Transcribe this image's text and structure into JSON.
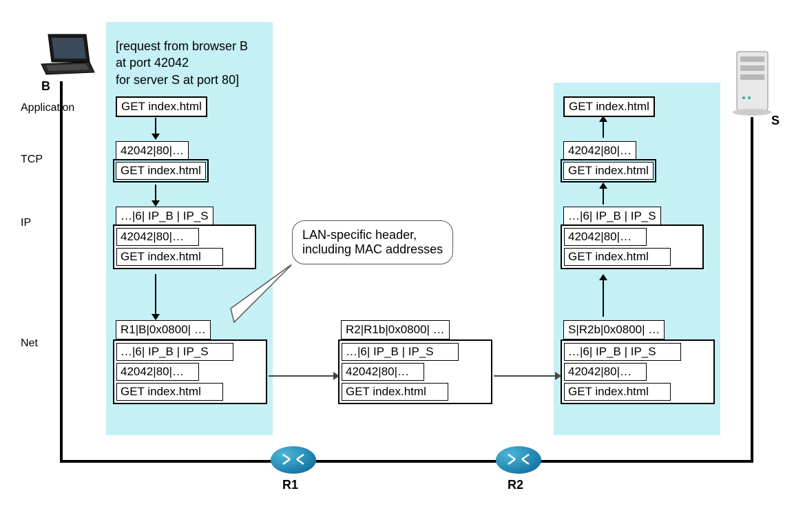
{
  "endpoints": {
    "browser_label": "B",
    "server_label": "S",
    "router1_label": "R1",
    "router2_label": "R2"
  },
  "header_note": {
    "line1": "[request from browser B",
    "line2": " at port 42042",
    "line3": " for server S at port 80]"
  },
  "layers": {
    "application": "Application",
    "tcp": "TCP",
    "ip": "IP",
    "net": "Net"
  },
  "callout": {
    "line1": "LAN-specific header,",
    "line2": "including MAC addresses"
  },
  "packets": {
    "app_payload": "GET index.html",
    "tcp_header": "42042|80|…",
    "ip_header": "…|6| IP_B | IP_S",
    "net_header_b": "R1|B|0x0800| …",
    "net_header_r1": "R2|R1b|0x0800| …",
    "net_header_r2": "S|R2b|0x0800| …"
  }
}
